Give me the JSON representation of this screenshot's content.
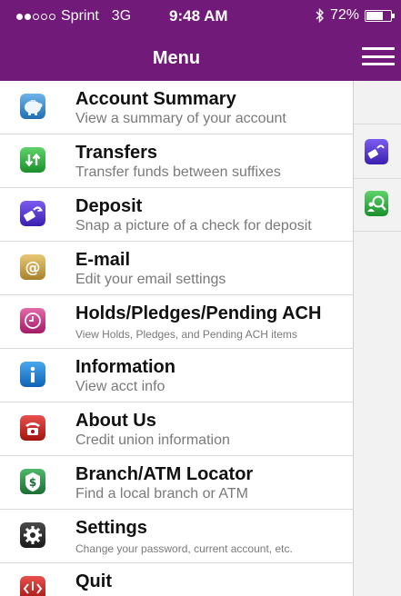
{
  "status_bar": {
    "carrier": "Sprint",
    "network": "3G",
    "time": "9:48 AM",
    "battery": "72%",
    "battery_level": 0.72,
    "signal_bars": 2
  },
  "header": {
    "title": "Menu"
  },
  "menu": {
    "items": [
      {
        "title": "Account Summary",
        "subtitle": "View a summary of your account",
        "icon": "piggy-bank-icon"
      },
      {
        "title": "Transfers",
        "subtitle": "Transfer funds between suffixes",
        "icon": "transfer-arrows-icon"
      },
      {
        "title": "Deposit",
        "subtitle": "Snap a picture of a check for deposit",
        "icon": "check-deposit-icon"
      },
      {
        "title": "E-mail",
        "subtitle": "Edit your email settings",
        "icon": "email-at-icon"
      },
      {
        "title": "Holds/Pledges/Pending ACH",
        "subtitle": "View Holds, Pledges, and Pending ACH items",
        "icon": "clock-icon"
      },
      {
        "title": "Information",
        "subtitle": "View acct info",
        "icon": "info-icon"
      },
      {
        "title": "About Us",
        "subtitle": "Credit union information",
        "icon": "phone-icon"
      },
      {
        "title": "Branch/ATM Locator",
        "subtitle": "Find a local branch or ATM",
        "icon": "dollar-locator-icon"
      },
      {
        "title": "Settings",
        "subtitle": "Change your password, current account, etc.",
        "icon": "gear-icon"
      },
      {
        "title": "Quit",
        "subtitle": "",
        "icon": "power-icon"
      }
    ]
  },
  "side_panel": {
    "icons": [
      "check-deposit-icon",
      "search-person-icon"
    ]
  },
  "colors": {
    "brand_purple": "#711a79",
    "title_text": "#111111",
    "subtitle_text": "#7a7a7a",
    "divider": "#d9d9d9"
  }
}
